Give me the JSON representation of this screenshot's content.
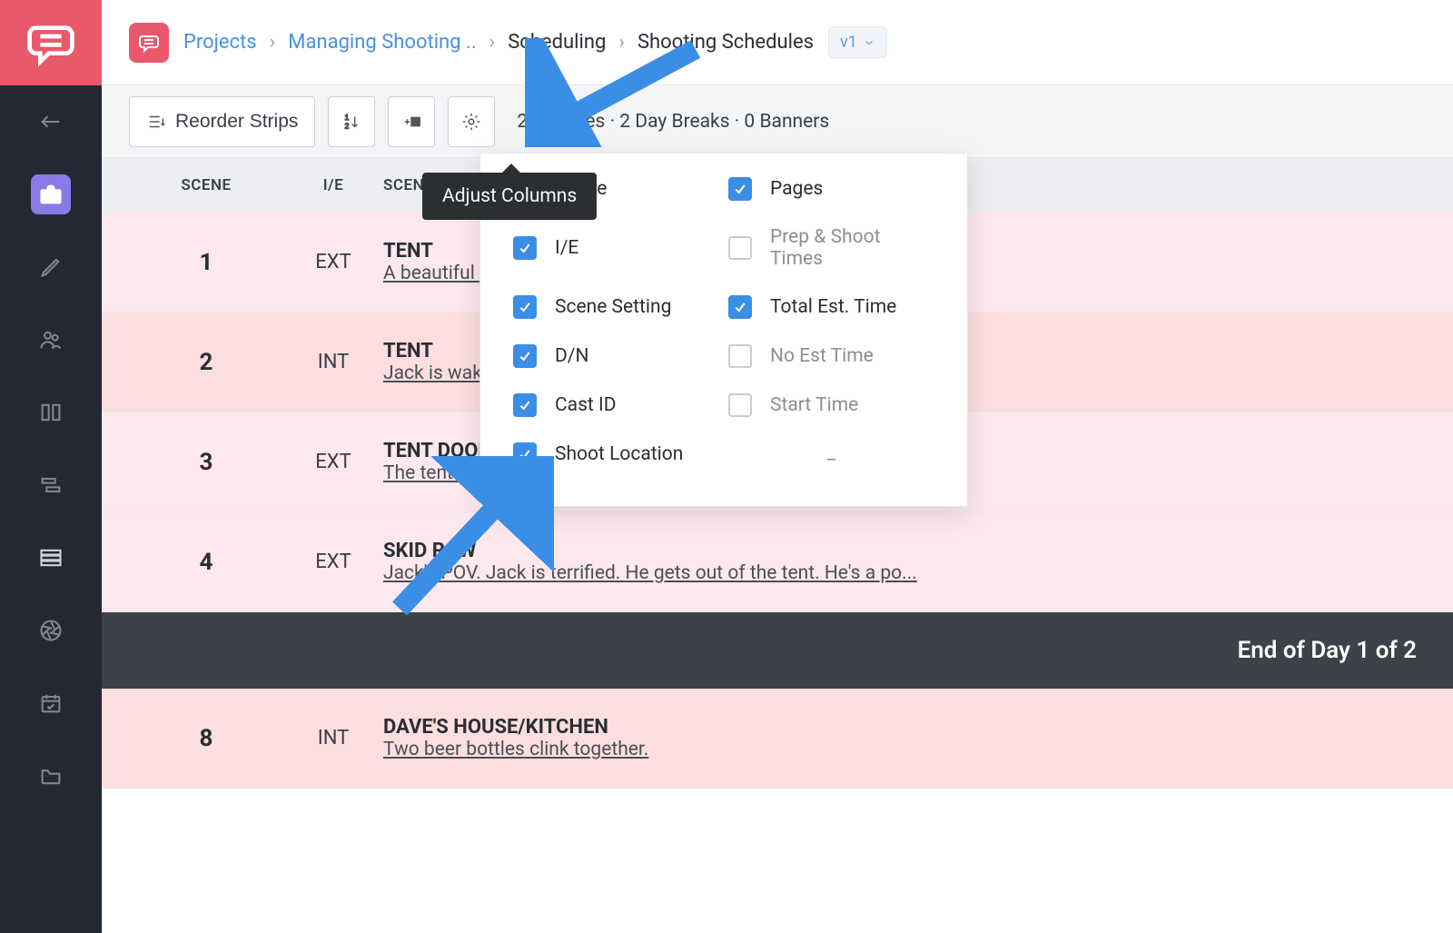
{
  "breadcrumb": {
    "projects": "Projects",
    "project_name": "Managing Shooting ..",
    "scheduling": "Scheduling",
    "shooting_schedules": "Shooting Schedules",
    "version": "v1"
  },
  "toolbar": {
    "reorder_strips": "Reorder Strips",
    "summary": "25 Scenes · 2 Day Breaks · 0 Banners"
  },
  "tooltip": {
    "adjust_columns": "Adjust Columns"
  },
  "columns": {
    "scene": "SCENE",
    "ie": "I/E",
    "setting": "SCENE SETTIN"
  },
  "dropdown": {
    "scene": "Scene",
    "pages": "Pages",
    "ie": "I/E",
    "prep_shoot": "Prep & Shoot Times",
    "scene_setting": "Scene Setting",
    "total_est": "Total Est. Time",
    "dn": "D/N",
    "no_est": "No Est Time",
    "cast_id": "Cast ID",
    "start_time": "Start Time",
    "shoot_location": "Shoot Location",
    "dash": "_"
  },
  "strips": [
    {
      "scene": "1",
      "ie": "EXT",
      "title": "TENT",
      "desc": "A beautiful sp",
      "variant": "pink"
    },
    {
      "scene": "2",
      "ie": "INT",
      "title": "TENT",
      "desc": "Jack is waking",
      "variant": "red"
    },
    {
      "scene": "3",
      "ie": "EXT",
      "title": "TENT DOOR",
      "desc": "The tent door",
      "variant": "pink"
    },
    {
      "scene": "4",
      "ie": "EXT",
      "title": "SKID ROW",
      "desc": "Jack's POV. Jack is terrified. He gets out of the tent. He's a po...",
      "variant": "pink"
    }
  ],
  "daybreak": {
    "label": "End of Day 1 of 2"
  },
  "strips2": [
    {
      "scene": "8",
      "ie": "INT",
      "title": "DAVE'S HOUSE/KITCHEN",
      "desc": "Two beer bottles clink together.",
      "variant": "red"
    }
  ]
}
